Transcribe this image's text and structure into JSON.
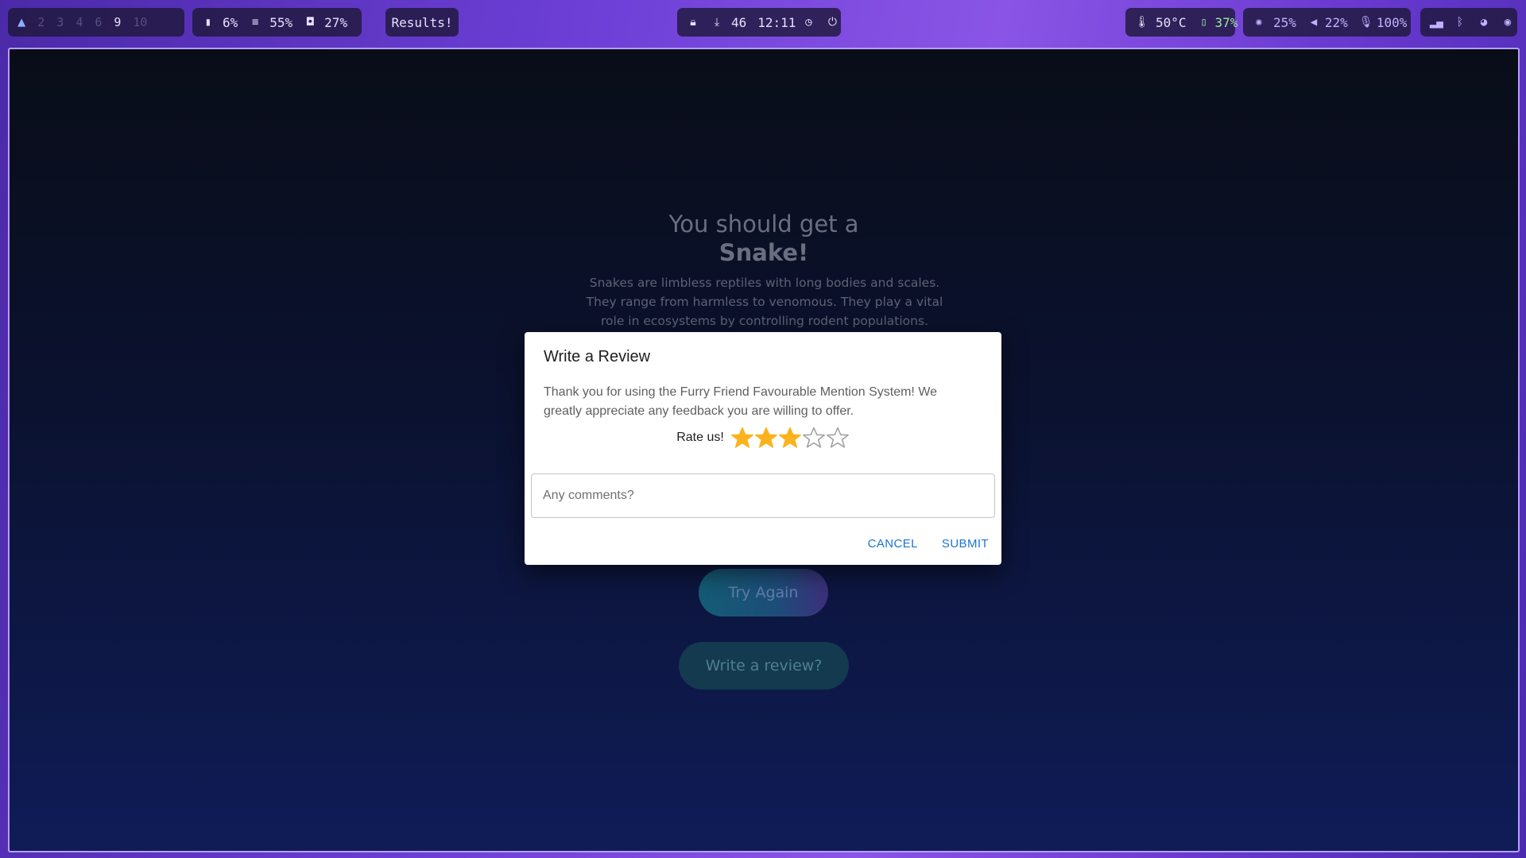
{
  "topbar": {
    "workspaces": [
      "2",
      "3",
      "4",
      "6",
      "9",
      "10"
    ],
    "active_workspace": "9",
    "stats": [
      {
        "icon": "cpu-icon",
        "value": "6%"
      },
      {
        "icon": "memory-icon",
        "value": "55%"
      },
      {
        "icon": "disk-icon",
        "value": "27%"
      }
    ],
    "window_title": "Results!",
    "center": {
      "lock_icon": "lock-icon",
      "updates_count": "46",
      "clock": "12:11"
    },
    "sensors": {
      "temperature": "50°C",
      "battery": "37%"
    },
    "controls": {
      "brightness": "25%",
      "volume": "22%",
      "microphone": "100%"
    },
    "colors": {
      "bar_pill": "#1e183c",
      "accent": "#8fb0ff",
      "battery_green": "#9be7a6"
    }
  },
  "page": {
    "heading_line1": "You should get a",
    "heading_line2": "Snake!",
    "description": "Snakes are limbless reptiles with long bodies and scales. They range from harmless to venomous. They play a vital role in ecosystems by controlling rodent populations. Some",
    "try_again_label": "Try Again",
    "write_review_label": "Write a review?"
  },
  "modal": {
    "title": "Write a Review",
    "body": "Thank you for using the Furry Friend Favourable Mention System! We greatly appreciate any feedback you are willing to offer.",
    "rate_label": "Rate us!",
    "rating": 3,
    "max_rating": 5,
    "star_color": "#fbb31d",
    "comment_placeholder": "Any comments?",
    "comment_value": "",
    "cancel_label": "CANCEL",
    "submit_label": "SUBMIT",
    "action_color": "#1976d2"
  }
}
